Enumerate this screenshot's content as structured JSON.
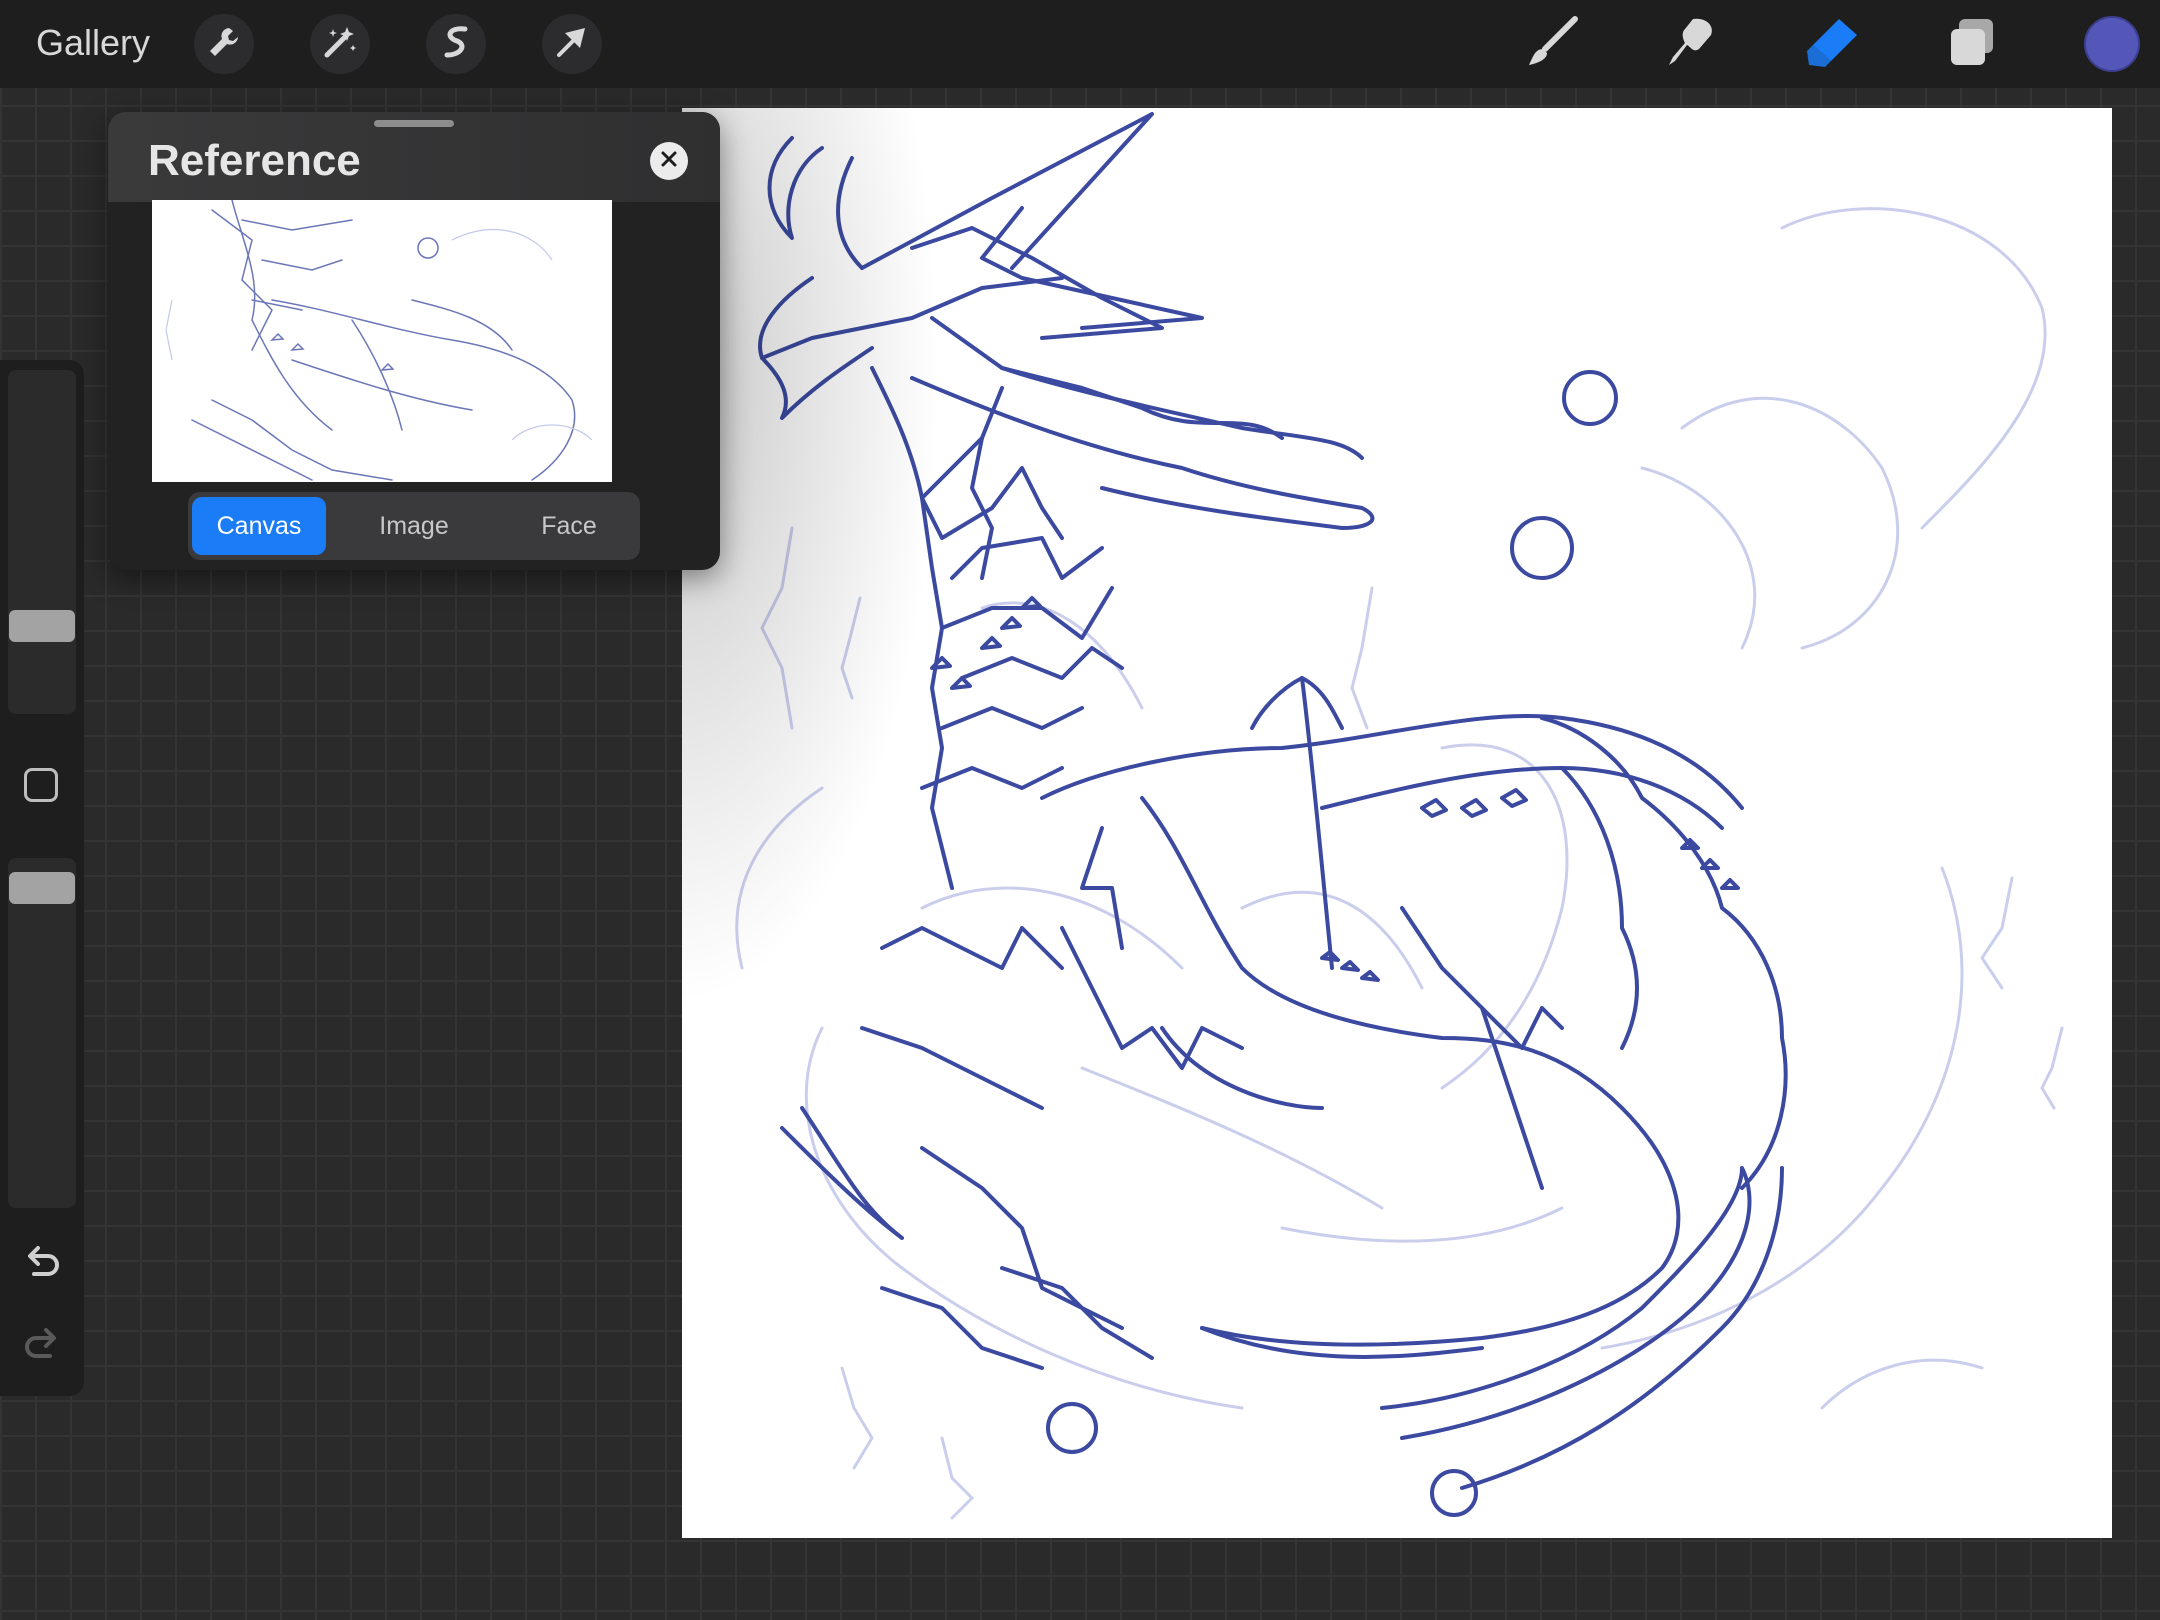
{
  "topbar": {
    "gallery_label": "Gallery",
    "left_tools": [
      "wrench-icon",
      "magic-wand-icon",
      "selection-icon",
      "transform-arrow-icon"
    ],
    "right_tools": [
      "brush-icon",
      "smudge-icon",
      "eraser-icon",
      "layers-icon"
    ],
    "active_tool": "eraser-icon",
    "current_color": "#5457b8"
  },
  "sidebar": {
    "controls": [
      "brush-size-slider",
      "modify-button",
      "opacity-slider",
      "undo-icon",
      "redo-icon"
    ]
  },
  "reference_panel": {
    "title": "Reference",
    "tabs": [
      {
        "label": "Canvas",
        "active": true
      },
      {
        "label": "Image",
        "active": false
      },
      {
        "label": "Face",
        "active": false
      }
    ]
  },
  "colors": {
    "accent": "#1a7cf7",
    "line_art": "#3b4aa0",
    "sketch": "#b8bfe6"
  }
}
